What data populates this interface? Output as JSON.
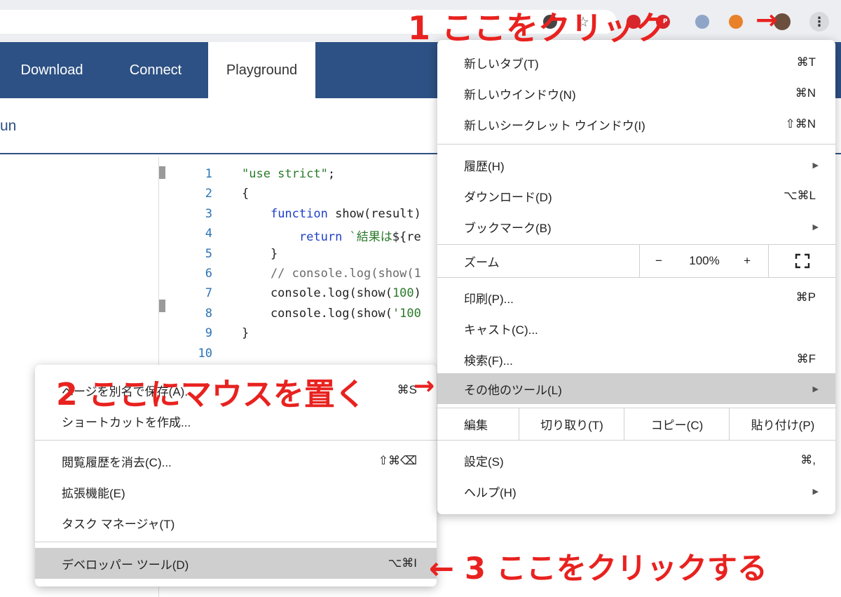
{
  "nav": {
    "tabs": [
      "Download",
      "Connect",
      "Playground"
    ],
    "run_partial": "un"
  },
  "toolbar": {
    "kebab_glyph": "⋮",
    "badge_text": "3P"
  },
  "editor": {
    "line_numbers": [
      "1",
      "2",
      "3",
      "4",
      "5",
      "6",
      "7",
      "8",
      "9",
      "10"
    ],
    "lines": [
      [
        {
          "t": "\"use strict\"",
          "c": "str"
        },
        {
          "t": ";",
          "c": ""
        }
      ],
      [
        {
          "t": "{",
          "c": ""
        }
      ],
      [
        {
          "t": "    ",
          "c": ""
        },
        {
          "t": "function",
          "c": "kw"
        },
        {
          "t": " show(result)",
          "c": ""
        }
      ],
      [
        {
          "t": "        ",
          "c": ""
        },
        {
          "t": "return",
          "c": "kw"
        },
        {
          "t": " `結果は",
          "c": "str"
        },
        {
          "t": "${re",
          "c": ""
        }
      ],
      [
        {
          "t": "    }",
          "c": ""
        }
      ],
      [
        {
          "t": "    // console.log(show(1",
          "c": "cm"
        }
      ],
      [
        {
          "t": "    console.log(show(",
          "c": ""
        },
        {
          "t": "100",
          "c": "num"
        },
        {
          "t": ")",
          "c": ""
        }
      ],
      [
        {
          "t": "    console.log(show(",
          "c": ""
        },
        {
          "t": "'100",
          "c": "str"
        }
      ],
      [
        {
          "t": "}",
          "c": ""
        }
      ],
      []
    ]
  },
  "main_menu": {
    "items": [
      {
        "label": "新しいタブ(T)",
        "shortcut": "⌘T"
      },
      {
        "label": "新しいウインドウ(N)",
        "shortcut": "⌘N"
      },
      {
        "label": "新しいシークレット ウインドウ(I)",
        "shortcut": "⇧⌘N"
      },
      {
        "label": "履歴(H)",
        "shortcut": "",
        "arrow": true
      },
      {
        "label": "ダウンロード(D)",
        "shortcut": "⌥⌘L"
      },
      {
        "label": "ブックマーク(B)",
        "shortcut": "",
        "arrow": true
      },
      {
        "label": "印刷(P)...",
        "shortcut": "⌘P"
      },
      {
        "label": "キャスト(C)...",
        "shortcut": ""
      },
      {
        "label": "検索(F)...",
        "shortcut": "⌘F"
      },
      {
        "label": "その他のツール(L)",
        "shortcut": "",
        "arrow": true
      },
      {
        "label": "設定(S)",
        "shortcut": "⌘,"
      },
      {
        "label": "ヘルプ(H)",
        "shortcut": "",
        "arrow": true
      }
    ],
    "zoom": {
      "label": "ズーム",
      "minus": "−",
      "value": "100%",
      "plus": "+"
    },
    "edit": {
      "label": "編集",
      "cut": "切り取り(T)",
      "copy": "コピー(C)",
      "paste": "貼り付け(P)"
    }
  },
  "sub_menu": {
    "items": [
      {
        "label": "ページを別名で保存(A)...",
        "shortcut": "⌘S"
      },
      {
        "label": "ショートカットを作成...",
        "shortcut": ""
      },
      {
        "label": "閲覧履歴を消去(C)...",
        "shortcut": "⇧⌘⌫"
      },
      {
        "label": "拡張機能(E)",
        "shortcut": ""
      },
      {
        "label": "タスク マネージャ(T)",
        "shortcut": ""
      },
      {
        "label": "デベロッパー ツール(D)",
        "shortcut": "⌥⌘I"
      }
    ]
  },
  "annotations": {
    "a1": "1 ここをクリック",
    "a1_arrow": "→",
    "a2": "2 ここにマウスを置く",
    "a2_arrow": "→",
    "a3": "← 3 ここをクリックする"
  },
  "colors": {
    "nav_bg": "#2d5184",
    "annotation": "#e8221f",
    "highlight": "#cfcfcf"
  }
}
